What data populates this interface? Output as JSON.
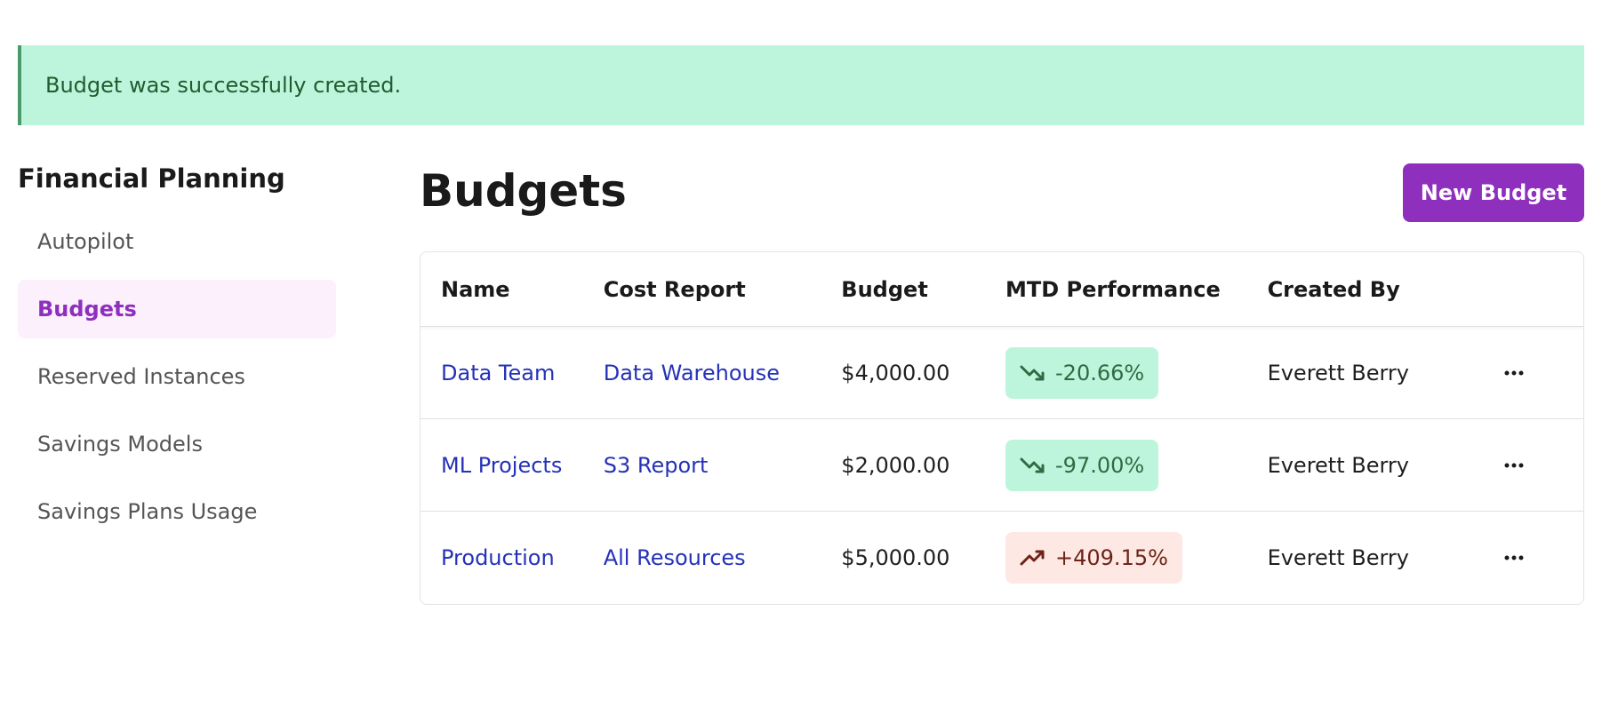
{
  "flash": {
    "message": "Budget was successfully created."
  },
  "sidebar": {
    "title": "Financial Planning",
    "items": [
      {
        "label": "Autopilot"
      },
      {
        "label": "Budgets"
      },
      {
        "label": "Reserved Instances"
      },
      {
        "label": "Savings Models"
      },
      {
        "label": "Savings Plans Usage"
      }
    ],
    "active_item": "Budgets"
  },
  "main": {
    "title": "Budgets",
    "new_button_label": "New Budget"
  },
  "table": {
    "headers": {
      "name": "Name",
      "cost_report": "Cost Report",
      "budget": "Budget",
      "mtd_performance": "MTD Performance",
      "created_by": "Created By"
    },
    "rows": [
      {
        "name": "Data Team",
        "cost_report": "Data Warehouse",
        "budget": "$4,000.00",
        "mtd_performance": "-20.66%",
        "trend": "down",
        "trend_icon": "trending-down-icon",
        "created_by": "Everett Berry"
      },
      {
        "name": "ML Projects",
        "cost_report": "S3 Report",
        "budget": "$2,000.00",
        "mtd_performance": "-97.00%",
        "trend": "down",
        "trend_icon": "trending-down-icon",
        "created_by": "Everett Berry"
      },
      {
        "name": "Production",
        "cost_report": "All Resources",
        "budget": "$5,000.00",
        "mtd_performance": "+409.15%",
        "trend": "up",
        "trend_icon": "trending-up-icon",
        "created_by": "Everett Berry"
      }
    ]
  },
  "colors": {
    "accent": "#8e2fbe",
    "link": "#2532b8",
    "success_bg": "#bdf5dc",
    "danger_bg": "#fde8e4"
  }
}
